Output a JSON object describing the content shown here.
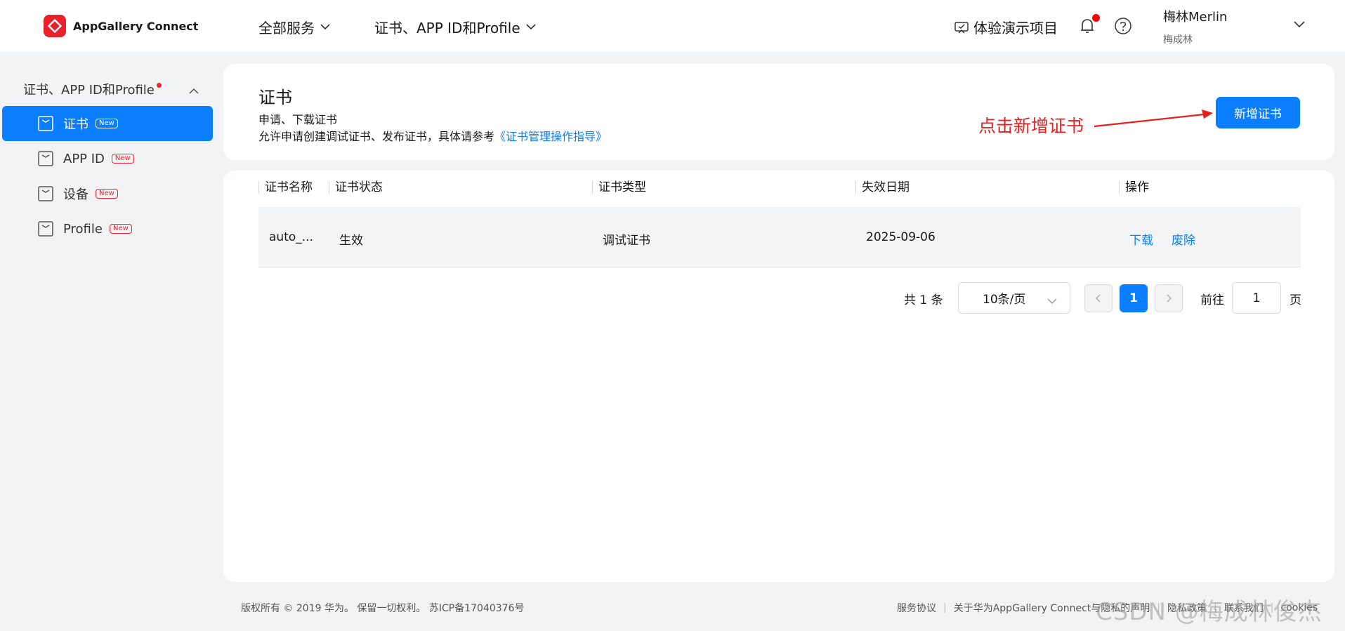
{
  "header": {
    "brand": "AppGallery Connect",
    "nav": [
      {
        "label": "全部服务"
      },
      {
        "label": "证书、APP ID和Profile"
      }
    ],
    "demo_label": "体验演示项目",
    "user_name": "梅林Merlin",
    "user_sub": "梅成林"
  },
  "sidebar": {
    "group_label": "证书、APP ID和Profile",
    "items": [
      {
        "label": "证书",
        "badge": "New",
        "active": true
      },
      {
        "label": "APP ID",
        "badge": "New"
      },
      {
        "label": "设备",
        "badge": "New"
      },
      {
        "label": "Profile",
        "badge": "New"
      }
    ]
  },
  "page": {
    "title": "证书",
    "desc1": "申请、下载证书",
    "desc2_prefix": "允许申请创建调试证书、发布证书，具体请参考",
    "desc2_link": "《证书管理操作指导》",
    "add_button": "新增证书",
    "annotation": "点击新增证书"
  },
  "table": {
    "columns": [
      "证书名称",
      "证书状态",
      "证书类型",
      "失效日期",
      "操作"
    ],
    "rows": [
      {
        "name": "auto_...",
        "status": "生效",
        "type": "调试证书",
        "expiry": "2025-09-06",
        "op_download": "下载",
        "op_revoke": "废除"
      }
    ]
  },
  "pagination": {
    "total": "共 1 条",
    "page_size": "10条/页",
    "current_page": "1",
    "goto_label": "前往",
    "goto_value": "1",
    "goto_unit": "页"
  },
  "footer": {
    "copyright": "版权所有 © 2019 华为。 保留一切权利。 苏ICP备17040376号",
    "links": [
      "服务协议",
      "关于华为AppGallery Connect与隐私的声明",
      "隐私政策",
      "联系我们",
      "cookies"
    ]
  },
  "watermark": "CSDN @梅成林俊杰",
  "colors": {
    "accent": "#0a7eff",
    "brand": "#e8212b",
    "annotation": "#e81f1f"
  }
}
